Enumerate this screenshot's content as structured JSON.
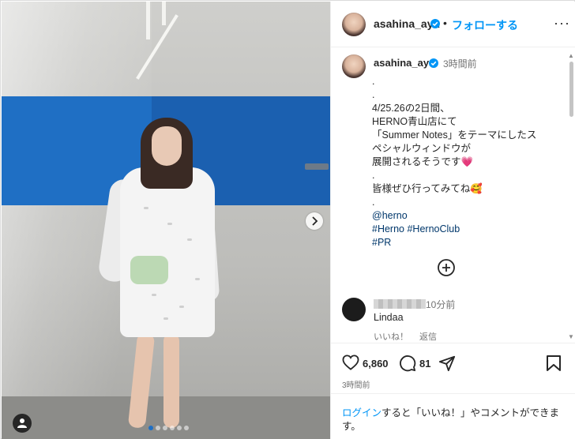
{
  "header": {
    "username": "asahina_aya",
    "separator": "•",
    "follow_label": "フォローする",
    "more_label": "···"
  },
  "caption": {
    "username": "asahina_aya",
    "time": "3時間前",
    "lines": [
      ".",
      ".",
      "4/25.26の2日間、",
      "HERNO青山店にて",
      "「Summer Notes」をテーマにしたス",
      "ペシャルウィンドウが",
      "展開されるそうです",
      ".",
      "皆様ぜひ行ってみてね",
      ".",
      "@herno",
      "#Herno #HernoClub",
      "#PR"
    ],
    "emoji_heart": "💗",
    "emoji_smile": "🥰"
  },
  "comment": {
    "time": "10分前",
    "text": "Lindaa",
    "like_label": "いいね！",
    "reply_label": "返信"
  },
  "actions": {
    "likes": "6,860",
    "comments": "81",
    "post_time": "3時間前"
  },
  "login": {
    "link": "ログイン",
    "text": "すると「いいね！」やコメントができます。"
  },
  "carousel": {
    "total_slides": 6,
    "current_slide": 1
  },
  "colors": {
    "accent": "#0095f6",
    "link": "#00376b",
    "stripe": "#1f6fc4"
  }
}
